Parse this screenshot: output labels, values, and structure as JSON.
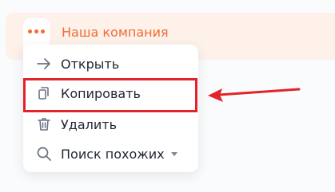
{
  "header": {
    "company_name": "Наша компания",
    "more_icon": "more-horizontal-dots-icon"
  },
  "menu": {
    "items": [
      {
        "label": "Открыть",
        "icon": "arrow-right-icon"
      },
      {
        "label": "Копировать",
        "icon": "copy-icon"
      },
      {
        "label": "Удалить",
        "icon": "trash-icon"
      },
      {
        "label": "Поиск похожих",
        "icon": "search-icon",
        "has_submenu": true
      }
    ],
    "highlighted_index": 1
  },
  "colors": {
    "accent": "#f06c35",
    "header_bg": "#fdf1ea",
    "text": "#1e2433",
    "icon": "#6a7384",
    "annotation_red": "#e2232a"
  }
}
